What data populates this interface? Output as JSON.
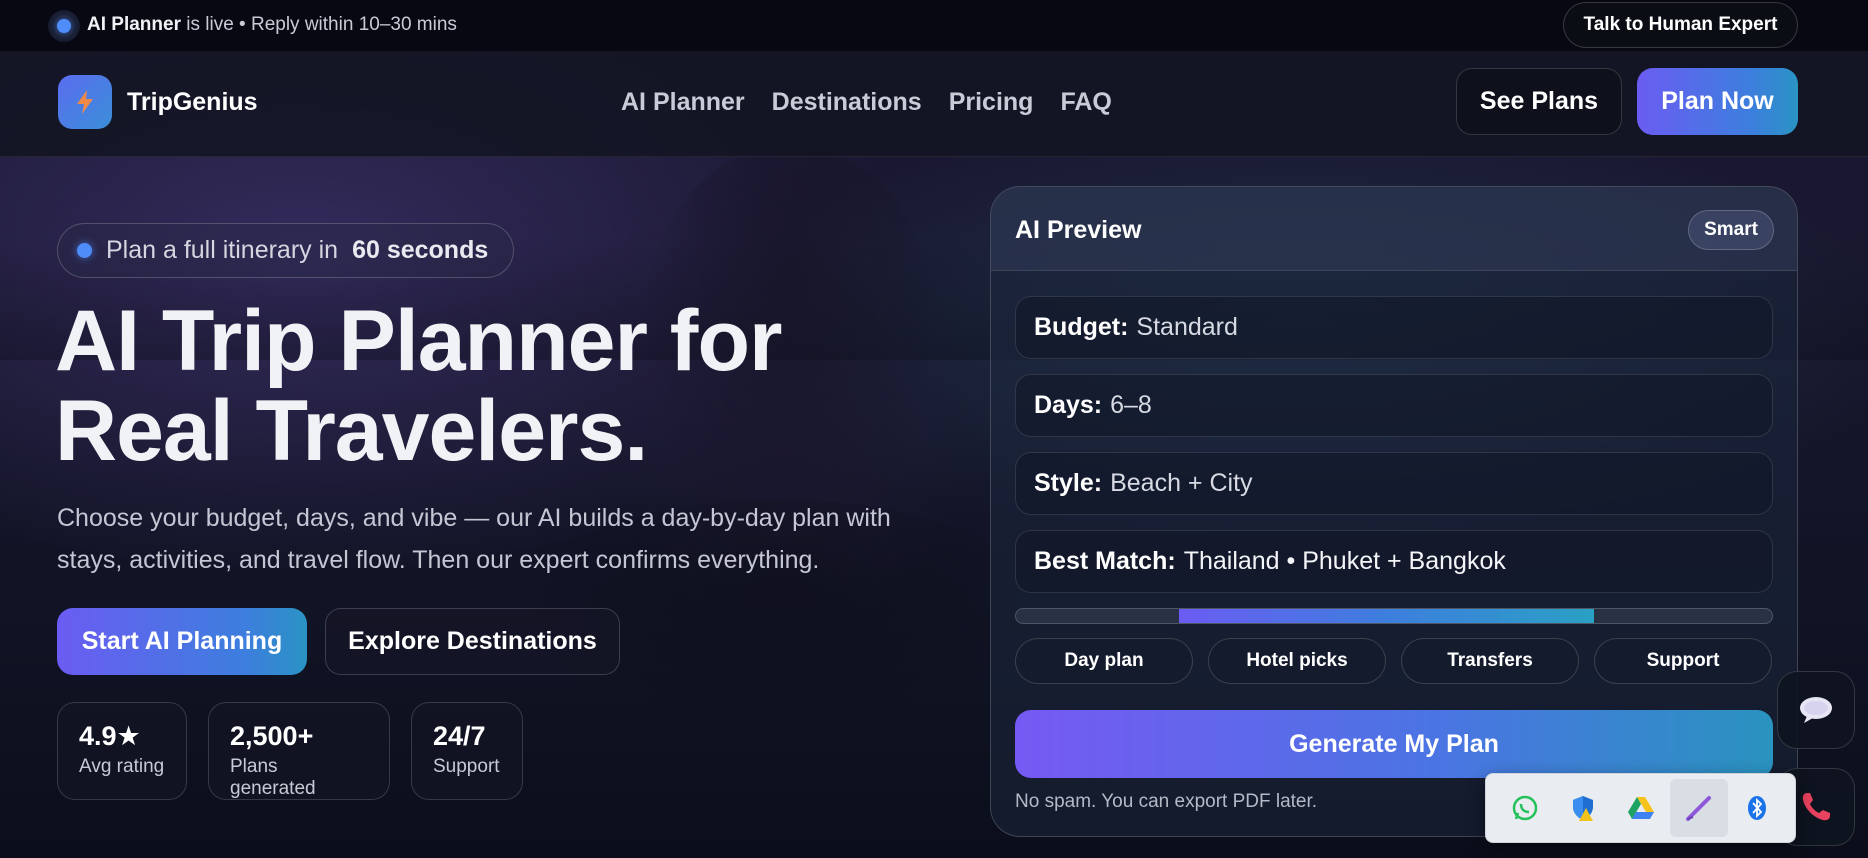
{
  "topbar": {
    "live_strong": "AI Planner",
    "live_rest": "is live • Reply within 10–30 mins",
    "talk_button": "Talk to Human Expert"
  },
  "nav": {
    "brand": "TripGenius",
    "links": [
      "AI Planner",
      "Destinations",
      "Pricing",
      "FAQ"
    ],
    "see_plans": "See Plans",
    "plan_now": "Plan Now"
  },
  "hero": {
    "pill_text": "Plan a full itinerary in",
    "pill_strong": "60 seconds",
    "title_line1": "AI Trip Planner for",
    "title_line2": "Real Travelers.",
    "subtitle": "Choose your budget, days, and vibe — our AI builds a day-by-day plan with stays, activities, and travel flow. Then our expert confirms everything.",
    "start_button": "Start AI Planning",
    "explore_button": "Explore Destinations",
    "stats": [
      {
        "value": "4.9★",
        "label": "Avg rating"
      },
      {
        "value": "2,500+",
        "label": "Plans generated"
      },
      {
        "value": "24/7",
        "label": "Support"
      }
    ]
  },
  "preview": {
    "title": "AI Preview",
    "badge": "Smart",
    "fields": [
      {
        "key": "Budget:",
        "value": "Standard"
      },
      {
        "key": "Days:",
        "value": "6–8"
      },
      {
        "key": "Style:",
        "value": "Beach + City"
      },
      {
        "key": "Best Match:",
        "value": "Thailand • Phuket + Bangkok"
      }
    ],
    "progress_start": 0.215,
    "progress_end": 0.765,
    "chips": [
      "Day plan",
      "Hotel picks",
      "Transfers",
      "Support"
    ],
    "generate_button": "Generate My Plan",
    "fineprint": "No spam. You can export PDF later."
  },
  "tray": {
    "icons": [
      "whatsapp-icon",
      "security-shield-icon",
      "google-drive-icon",
      "pen-icon",
      "bluetooth-icon"
    ]
  },
  "colors": {
    "accent_start": "#6b5cf2",
    "accent_end": "#2a93c4",
    "live_dot": "#4f8dfa"
  }
}
